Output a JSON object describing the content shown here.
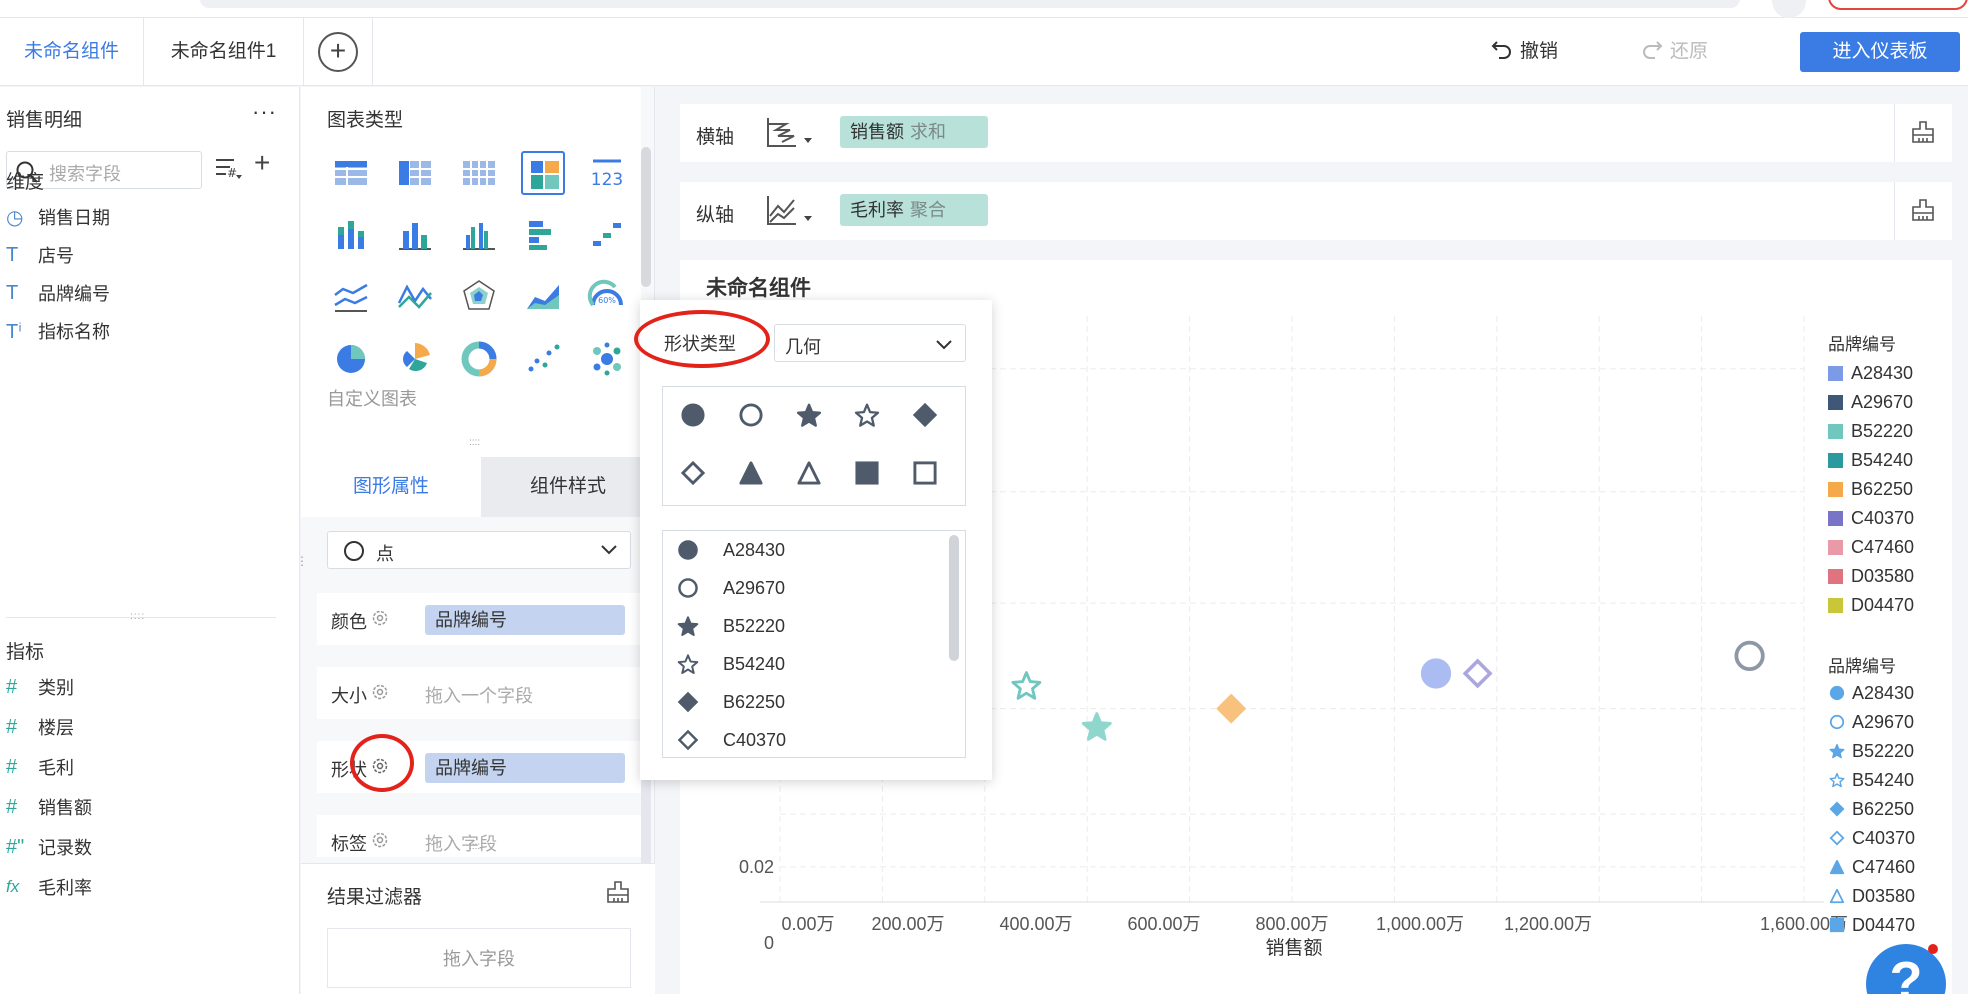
{
  "tabs": [
    {
      "label": "未命名组件"
    },
    {
      "label": "未命名组件1"
    }
  ],
  "toolbar": {
    "undo": "撤销",
    "redo": "还原",
    "enter_dashboard": "进入仪表板"
  },
  "left_panel": {
    "dataset": "销售明细",
    "search_placeholder": "搜索字段",
    "dimensions_title": "维度",
    "dimensions": [
      {
        "label": "销售日期",
        "icon": "clock-icon"
      },
      {
        "label": "店号",
        "icon": "text-icon"
      },
      {
        "label": "品牌编号",
        "icon": "text-icon"
      },
      {
        "label": "指标名称",
        "icon": "text-icon"
      }
    ],
    "measures_title": "指标",
    "measures": [
      {
        "label": "类别",
        "icon": "hash-icon"
      },
      {
        "label": "楼层",
        "icon": "hash-icon"
      },
      {
        "label": "毛利",
        "icon": "hash-icon"
      },
      {
        "label": "销售额",
        "icon": "hash-icon"
      },
      {
        "label": "记录数",
        "icon": "hash-icon"
      },
      {
        "label": "毛利率",
        "icon": "formula-icon"
      }
    ]
  },
  "chart_panel": {
    "title": "图表类型",
    "custom": "自定义图表",
    "tabs": {
      "graphic": "图形属性",
      "style": "组件样式"
    },
    "mark_type": "点",
    "props": {
      "color_label": "颜色",
      "color_field": "品牌编号",
      "size_label": "大小",
      "size_placeholder": "拖入一个字段",
      "shape_label": "形状",
      "shape_field": "品牌编号",
      "label_label": "标签",
      "label_placeholder": "拖入字段"
    },
    "filter_title": "结果过滤器",
    "filter_placeholder": "拖入字段"
  },
  "shelves": {
    "x_label": "横轴",
    "x_field": "销售额",
    "x_agg": "求和",
    "y_label": "纵轴",
    "y_field": "毛利率",
    "y_agg": "聚合"
  },
  "component_title": "未命名组件",
  "popup": {
    "shape_type_label": "形状类型",
    "shape_type_value": "几何",
    "list": [
      {
        "label": "A28430",
        "shape": "circle"
      },
      {
        "label": "A29670",
        "shape": "circle-outline"
      },
      {
        "label": "B52220",
        "shape": "star"
      },
      {
        "label": "B54240",
        "shape": "star-outline"
      },
      {
        "label": "B62250",
        "shape": "diamond"
      },
      {
        "label": "C40370",
        "shape": "diamond-outline"
      }
    ]
  },
  "legend_color": {
    "title": "品牌编号",
    "items": [
      {
        "label": "A28430",
        "color": "#7b9be6"
      },
      {
        "label": "A29670",
        "color": "#3f5878"
      },
      {
        "label": "B52220",
        "color": "#6fc7bd"
      },
      {
        "label": "B54240",
        "color": "#2a9a9f"
      },
      {
        "label": "B62250",
        "color": "#f5a94a"
      },
      {
        "label": "C40370",
        "color": "#7a74c9"
      },
      {
        "label": "C47460",
        "color": "#e99aa8"
      },
      {
        "label": "D03580",
        "color": "#e07380"
      },
      {
        "label": "D04470",
        "color": "#c9c63a"
      }
    ]
  },
  "legend_shape": {
    "title": "品牌编号",
    "items": [
      {
        "label": "A28430",
        "shape": "circle"
      },
      {
        "label": "A29670",
        "shape": "circle-outline"
      },
      {
        "label": "B52220",
        "shape": "star"
      },
      {
        "label": "B54240",
        "shape": "star-outline"
      },
      {
        "label": "B62250",
        "shape": "diamond"
      },
      {
        "label": "C40370",
        "shape": "diamond-outline"
      },
      {
        "label": "C47460",
        "shape": "triangle"
      },
      {
        "label": "D03580",
        "shape": "triangle-outline"
      },
      {
        "label": "D04470",
        "shape": "square"
      }
    ]
  },
  "chart_data": {
    "type": "scatter",
    "xlabel": "销售额",
    "x_ticks": [
      "0.00万",
      "200.00万",
      "400.00万",
      "600.00万",
      "800.00万",
      "1,000.00万",
      "1,200.00万",
      "1,600.00万"
    ],
    "x_tick_values": [
      0,
      200,
      400,
      600,
      800,
      1000,
      1200,
      1600
    ],
    "y_ticks": [
      "0.02",
      "0"
    ],
    "xlim": [
      0,
      1600
    ],
    "points": [
      {
        "brand": "B54240",
        "x": 385,
        "y_visual": 0.37,
        "shape": "star-outline",
        "color": "#6fc7bd"
      },
      {
        "brand": "B52220",
        "x": 495,
        "y_visual": 0.3,
        "shape": "star",
        "color": "#8fd6cd"
      },
      {
        "brand": "B62250",
        "x": 705,
        "y_visual": 0.33,
        "shape": "diamond",
        "color": "#f8c27e"
      },
      {
        "brand": "A28430",
        "x": 1025,
        "y_visual": 0.39,
        "shape": "circle",
        "color": "#aabcf1"
      },
      {
        "brand": "C40370",
        "x": 1090,
        "y_visual": 0.39,
        "shape": "diamond-outline",
        "color": "#aaa6de"
      },
      {
        "brand": "A29670",
        "x": 1515,
        "y_visual": 0.42,
        "shape": "circle-outline",
        "color": "#8d97a6"
      }
    ]
  }
}
